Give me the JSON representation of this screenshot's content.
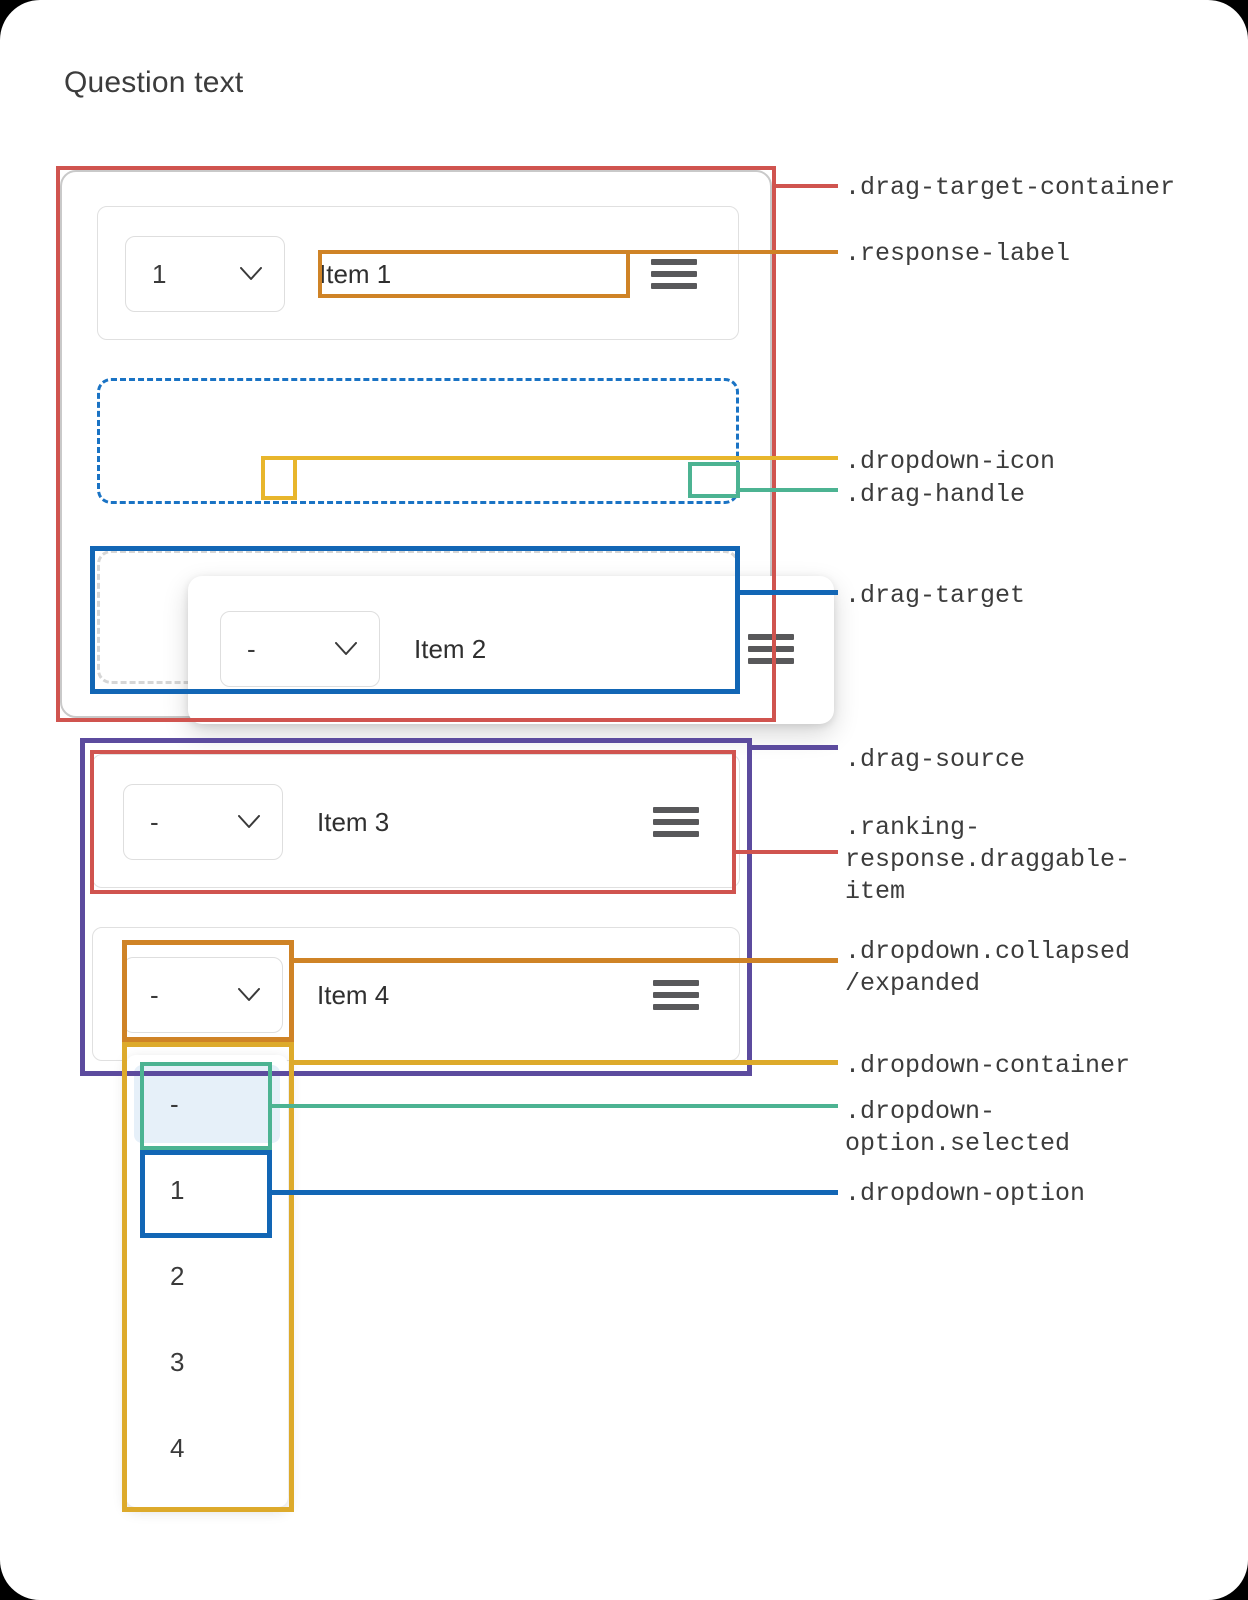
{
  "page": {
    "title": "Question text",
    "background": "#ffffff"
  },
  "colors": {
    "drag_target_container": "#d0544f",
    "response_label": "#cf8326",
    "dropdown_icon": "#e8b62c",
    "drag_handle": "#4cb392",
    "drag_target": "#1266b5",
    "drag_source": "#5c4b9e",
    "ranking_response": "#d0544f",
    "dropdown_collapsed": "#cf8326",
    "dropdown_container": "#ddaa2b",
    "dropdown_option_selected": "#4cb392",
    "dropdown_option": "#1266b5",
    "selected_option_bg": "#e6f0f9",
    "card_border": "#e0e0e0",
    "handle_bar": "#58585a"
  },
  "drag_target_container": {
    "items": [
      {
        "rank": "1",
        "label": "Item 1",
        "dropdown_icon": "chevron-down-icon",
        "handle_icon": "drag-handle-icon"
      }
    ],
    "dragging_item": {
      "rank": "-",
      "label": "Item 2",
      "dropdown_icon": "chevron-down-icon",
      "handle_icon": "drag-handle-icon"
    }
  },
  "drag_source": {
    "items": [
      {
        "rank": "-",
        "label": "Item 3",
        "dropdown_icon": "chevron-down-icon",
        "handle_icon": "drag-handle-icon"
      },
      {
        "rank": "-",
        "label": "Item 4",
        "dropdown_icon": "chevron-down-icon",
        "handle_icon": "drag-handle-icon"
      }
    ]
  },
  "dropdown": {
    "selected_value": "-",
    "options": [
      {
        "value": "-",
        "selected": true
      },
      {
        "value": "1",
        "selected": false
      },
      {
        "value": "2",
        "selected": false
      },
      {
        "value": "3",
        "selected": false
      },
      {
        "value": "4",
        "selected": false
      }
    ]
  },
  "annotations": [
    {
      "id": "drag-target-container",
      "text": ".drag-target-container",
      "color": "#d0544f"
    },
    {
      "id": "response-label",
      "text": ".response-label",
      "color": "#cf8326"
    },
    {
      "id": "dropdown-icon",
      "text": ".dropdown-icon",
      "color": "#e8b62c"
    },
    {
      "id": "drag-handle",
      "text": ".drag-handle",
      "color": "#4cb392"
    },
    {
      "id": "drag-target",
      "text": ".drag-target",
      "color": "#1266b5"
    },
    {
      "id": "drag-source",
      "text": ".drag-source",
      "color": "#5c4b9e"
    },
    {
      "id": "ranking-response",
      "text": ".ranking-\nresponse.draggable-\nitem",
      "color": "#d0544f"
    },
    {
      "id": "dropdown-collapsed",
      "text": ".dropdown.collapsed\n/expanded",
      "color": "#cf8326"
    },
    {
      "id": "dropdown-container",
      "text": ".dropdown-container",
      "color": "#ddaa2b"
    },
    {
      "id": "dropdown-option-selected",
      "text": ".dropdown-\noption.selected",
      "color": "#4cb392"
    },
    {
      "id": "dropdown-option",
      "text": ".dropdown-option",
      "color": "#1266b5"
    }
  ]
}
